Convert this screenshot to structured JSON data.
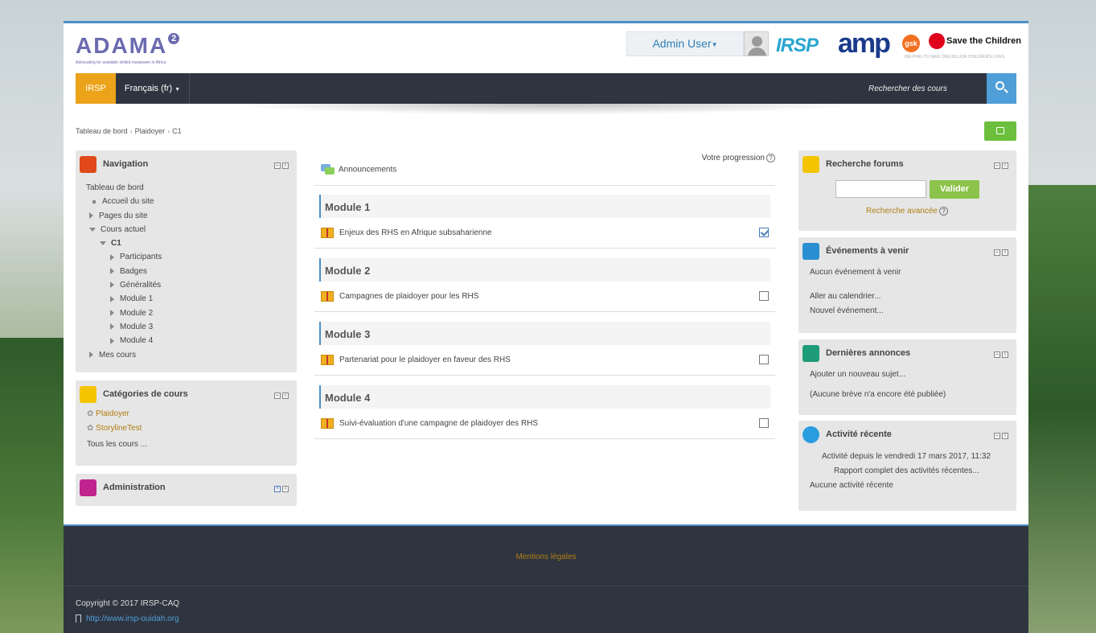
{
  "header": {
    "logo_text": "ADAMA",
    "logo_sup": "2",
    "logo_tagline": "Advocating for available skilled manpower in Africa",
    "user_menu": "Admin User",
    "partners": {
      "irsp": "IRSP",
      "amp": "amp",
      "gsk": "gsk",
      "stc": "Save the Children",
      "stc_sub": "HELPING TO SAVE ONE BILLION CHILDREN'S LIVES"
    }
  },
  "navbar": {
    "home": "IRSP",
    "language": "Français (fr)",
    "search_placeholder": "Rechercher des cours"
  },
  "breadcrumb": [
    "Tableau de bord",
    "Plaidoyer",
    "C1"
  ],
  "navigation": {
    "title": "Navigation",
    "items": [
      {
        "label": "Tableau de bord",
        "level": 0,
        "marker": "none"
      },
      {
        "label": "Accueil du site",
        "level": 1,
        "marker": "square"
      },
      {
        "label": "Pages du site",
        "level": 1,
        "marker": "right"
      },
      {
        "label": "Cours actuel",
        "level": 1,
        "marker": "down"
      },
      {
        "label": "C1",
        "level": 2,
        "marker": "down"
      },
      {
        "label": "Participants",
        "level": 3,
        "marker": "right"
      },
      {
        "label": "Badges",
        "level": 3,
        "marker": "right"
      },
      {
        "label": "Généralités",
        "level": 3,
        "marker": "right"
      },
      {
        "label": "Module 1",
        "level": 3,
        "marker": "right"
      },
      {
        "label": "Module 2",
        "level": 3,
        "marker": "right"
      },
      {
        "label": "Module 3",
        "level": 3,
        "marker": "right"
      },
      {
        "label": "Module 4",
        "level": 3,
        "marker": "right"
      },
      {
        "label": "Mes cours",
        "level": 1,
        "marker": "right"
      }
    ]
  },
  "categories": {
    "title": "Catégories de cours",
    "items": [
      "Plaidoyer",
      "StorylineTest"
    ],
    "all": "Tous les cours ..."
  },
  "administration": {
    "title": "Administration"
  },
  "course": {
    "progress_label": "Votre progression",
    "announcements": "Announcements",
    "modules": [
      {
        "title": "Module 1",
        "activity": "Enjeux des RHS en Afrique subsaharienne",
        "done": true
      },
      {
        "title": "Module 2",
        "activity": "Campagnes de plaidoyer pour les RHS",
        "done": false
      },
      {
        "title": "Module 3",
        "activity": "Partenariat pour le plaidoyer en faveur des RHS",
        "done": false
      },
      {
        "title": "Module 4",
        "activity": "Suivi-évaluation d'une campagne de plaidoyer des RHS",
        "done": false
      }
    ]
  },
  "forum_search": {
    "title": "Recherche forums",
    "button": "Valider",
    "advanced": "Recherche avancée"
  },
  "events": {
    "title": "Événements à venir",
    "none": "Aucun événement à venir",
    "calendar": "Aller au calendrier...",
    "new": "Nouvel événement..."
  },
  "news": {
    "title": "Dernières annonces",
    "add": "Ajouter un nouveau sujet...",
    "none": "(Aucune brève n'a encore été publiée)"
  },
  "recent": {
    "title": "Activité récente",
    "since": "Activité depuis le vendredi 17 mars 2017, 11:32",
    "report": "Rapport complet des activités récentes...",
    "none": "Aucune activité récente"
  },
  "footer": {
    "legal": "Mentions légales",
    "copyright": "Copyright © 2017 IRSP-CAQ",
    "url": "http://www.irsp-ouidah.org"
  },
  "colors": {
    "accent": "#eca31a",
    "navbar": "#2f3540",
    "link": "#b07d12",
    "blue": "#4a90c8",
    "green": "#6bbf3c"
  }
}
